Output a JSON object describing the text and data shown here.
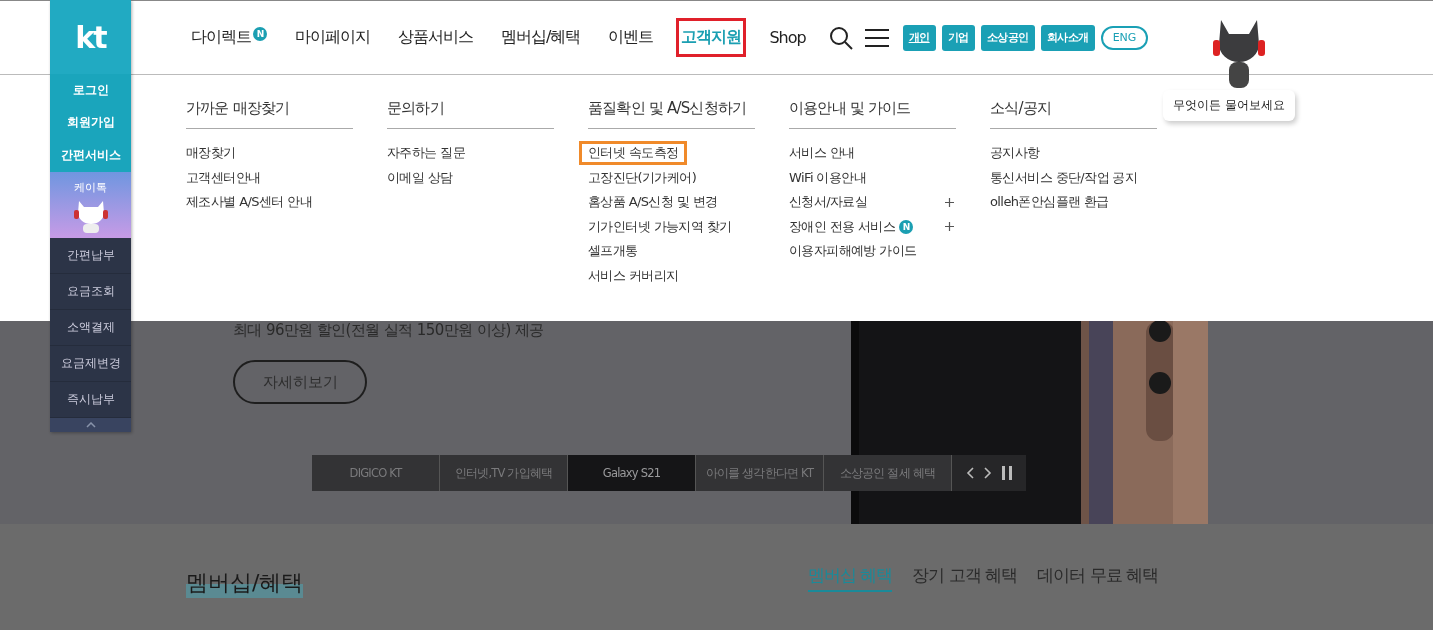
{
  "logo": {
    "text": "kt"
  },
  "nav": [
    {
      "label": "다이렉트",
      "badge": "N",
      "selected": false,
      "highlighted": false
    },
    {
      "label": "마이페이지",
      "selected": false,
      "highlighted": false
    },
    {
      "label": "상품서비스",
      "selected": false,
      "highlighted": false
    },
    {
      "label": "멤버십/혜택",
      "selected": false,
      "highlighted": false
    },
    {
      "label": "이벤트",
      "selected": false,
      "highlighted": false
    },
    {
      "label": "고객지원",
      "selected": true,
      "highlighted": true
    },
    {
      "label": "Shop",
      "selected": false,
      "highlighted": false
    }
  ],
  "segments": [
    {
      "label": "개인",
      "selected": true
    },
    {
      "label": "기업",
      "selected": false
    },
    {
      "label": "소상공인",
      "selected": false
    },
    {
      "label": "회사소개",
      "selected": false
    }
  ],
  "language_button": "ENG",
  "chatbot": {
    "bubble": "무엇이든 물어보세요"
  },
  "quick_menu": {
    "top_items": [
      "로그인",
      "회원가입",
      "간편서비스"
    ],
    "chat": "케이톡",
    "bottom_items": [
      "간편납부",
      "요금조회",
      "소액결제",
      "요금제변경",
      "즉시납부"
    ]
  },
  "mega_menu": [
    {
      "title": "가까운 매장찾기",
      "items": [
        {
          "label": "매장찾기",
          "highlighted": false,
          "expandable": false
        },
        {
          "label": "고객센터안내",
          "highlighted": false,
          "expandable": false
        },
        {
          "label": "제조사별 A/S센터 안내",
          "highlighted": false,
          "expandable": false
        }
      ]
    },
    {
      "title": "문의하기",
      "items": [
        {
          "label": "자주하는 질문",
          "highlighted": false,
          "expandable": false
        },
        {
          "label": "이메일 상담",
          "highlighted": false,
          "expandable": false
        }
      ]
    },
    {
      "title": "품질확인 및 A/S신청하기",
      "items": [
        {
          "label": "인터넷 속도측정",
          "highlighted": true,
          "expandable": false
        },
        {
          "label": "고장진단(기가케어)",
          "highlighted": false,
          "expandable": false
        },
        {
          "label": "홈상품 A/S신청 및 변경",
          "highlighted": false,
          "expandable": false
        },
        {
          "label": "기가인터넷 가능지역 찾기",
          "highlighted": false,
          "expandable": false
        },
        {
          "label": "셀프개통",
          "highlighted": false,
          "expandable": false
        },
        {
          "label": "서비스 커버리지",
          "highlighted": false,
          "expandable": false
        }
      ]
    },
    {
      "title": "이용안내 및 가이드",
      "items": [
        {
          "label": "서비스 안내",
          "highlighted": false,
          "expandable": false
        },
        {
          "label": "WiFi 이용안내",
          "highlighted": false,
          "expandable": false
        },
        {
          "label": "신청서/자료실",
          "highlighted": false,
          "expandable": true
        },
        {
          "label": "장애인 전용 서비스",
          "badge": "N",
          "highlighted": false,
          "expandable": true
        },
        {
          "label": "이용자피해예방 가이드",
          "highlighted": false,
          "expandable": false
        }
      ]
    },
    {
      "title": "소식/공지",
      "items": [
        {
          "label": "공지사항",
          "highlighted": false,
          "expandable": false
        },
        {
          "label": "통신서비스 중단/작업 공지",
          "highlighted": false,
          "expandable": false
        },
        {
          "label": "olleh폰안심플랜 환급",
          "highlighted": false,
          "expandable": false
        }
      ]
    }
  ],
  "hero": {
    "text": "최대 96만원 할인(전월 실적 150만원 이상) 제공",
    "button": "자세히보기",
    "slides": [
      {
        "label": "DIGICO KT",
        "selected": false
      },
      {
        "label": "인터넷,TV 가입혜택",
        "selected": false
      },
      {
        "label": "Galaxy S21",
        "selected": true
      },
      {
        "label": "아이를 생각한다면 KT",
        "selected": false
      },
      {
        "label": "소상공인 절세 혜택",
        "selected": false
      }
    ]
  },
  "membership": {
    "title": "멤버십/혜택",
    "tabs": [
      {
        "label": "멤버십 혜택",
        "selected": true
      },
      {
        "label": "장기 고객 혜택",
        "selected": false
      },
      {
        "label": "데이터 무료 혜택",
        "selected": false
      }
    ]
  }
}
